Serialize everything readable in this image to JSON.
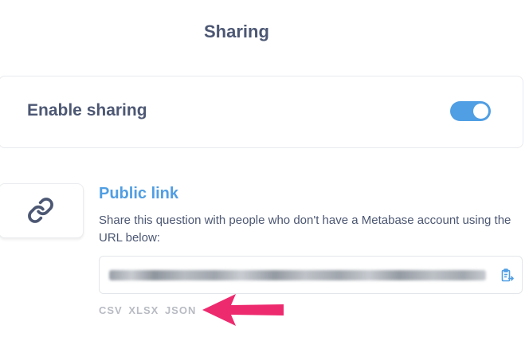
{
  "page": {
    "title": "Sharing"
  },
  "enable_sharing": {
    "label": "Enable sharing",
    "enabled": true
  },
  "public_link": {
    "icon": "link-icon",
    "title": "Public link",
    "description": "Share this question with people who don't have a Metabase account using the URL below:",
    "copy_icon": "copy-icon",
    "formats": [
      "CSV",
      "XLSX",
      "JSON"
    ]
  },
  "colors": {
    "accent": "#509ee3",
    "text": "#4c5773",
    "muted": "#b8bbc3",
    "annotation_arrow": "#ee2a6e"
  }
}
